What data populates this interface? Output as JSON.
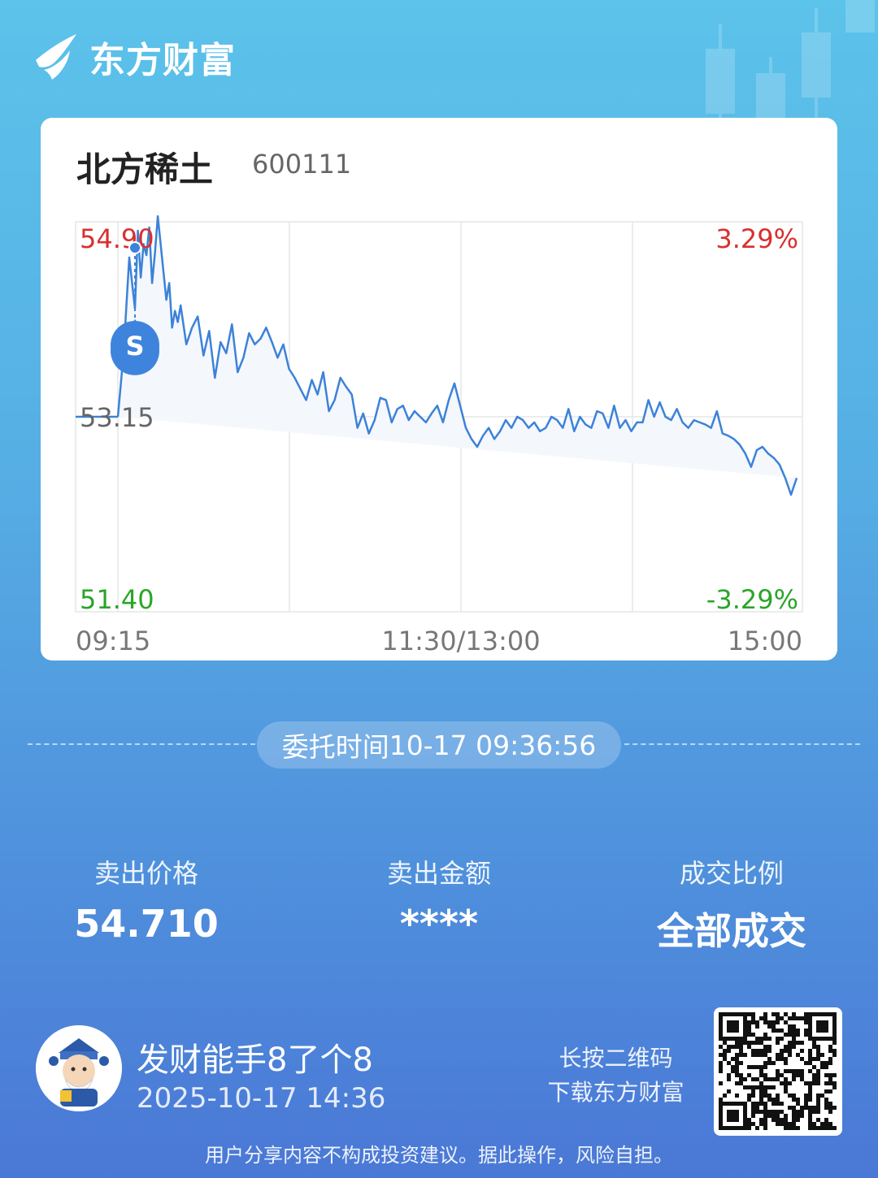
{
  "brand": {
    "name": "东方财富"
  },
  "stock": {
    "name": "北方稀土",
    "code": "600111"
  },
  "chart_data": {
    "type": "line",
    "y_labels": {
      "top_price": "54.90",
      "mid_price": "53.15",
      "bottom_price": "51.40",
      "top_pct": "3.29%",
      "bottom_pct": "-3.29%"
    },
    "x_labels": [
      "09:15",
      "11:30/13:00",
      "15:00"
    ],
    "ylim": [
      51.4,
      54.9
    ],
    "x_unit": "trading minutes after 09:30",
    "x": [
      0,
      2,
      4,
      6,
      7,
      8,
      9,
      10,
      11,
      12,
      13,
      14,
      15,
      16,
      17,
      18,
      19,
      20,
      21,
      22,
      24,
      26,
      28,
      30,
      32,
      34,
      36,
      38,
      40,
      42,
      44,
      46,
      48,
      50,
      52,
      54,
      56,
      58,
      60,
      62,
      64,
      66,
      68,
      70,
      72,
      74,
      76,
      78,
      80,
      82,
      84,
      86,
      88,
      90,
      92,
      94,
      96,
      98,
      100,
      102,
      104,
      106,
      108,
      110,
      112,
      114,
      116,
      118,
      120,
      122,
      124,
      126,
      128,
      130,
      132,
      134,
      136,
      138,
      140,
      142,
      144,
      146,
      148,
      150,
      152,
      154,
      156,
      158,
      160,
      162,
      164,
      166,
      168,
      170,
      172,
      174,
      176,
      178,
      180,
      182,
      184,
      186,
      188,
      190,
      192,
      194,
      196,
      198,
      200,
      202,
      204,
      206,
      208,
      210,
      212,
      214,
      216,
      218,
      220,
      222,
      224,
      226,
      228,
      230,
      232,
      234,
      236,
      238,
      240
    ],
    "price": [
      53.15,
      53.72,
      54.58,
      54.12,
      54.82,
      54.4,
      54.7,
      54.6,
      54.85,
      54.35,
      54.62,
      54.95,
      54.7,
      54.45,
      54.2,
      54.35,
      53.95,
      54.1,
      54.0,
      54.15,
      53.8,
      53.95,
      54.05,
      53.7,
      53.92,
      53.5,
      53.82,
      53.72,
      53.98,
      53.55,
      53.68,
      53.9,
      53.8,
      53.85,
      53.95,
      53.82,
      53.68,
      53.8,
      53.58,
      53.5,
      53.4,
      53.3,
      53.48,
      53.35,
      53.55,
      53.2,
      53.3,
      53.5,
      53.42,
      53.35,
      53.05,
      53.18,
      53.0,
      53.12,
      53.32,
      53.3,
      53.1,
      53.22,
      53.25,
      53.12,
      53.2,
      53.15,
      53.1,
      53.18,
      53.25,
      53.1,
      53.3,
      53.45,
      53.25,
      53.05,
      52.95,
      52.88,
      52.98,
      53.05,
      52.95,
      53.02,
      53.12,
      53.05,
      53.15,
      53.12,
      53.05,
      53.1,
      53.02,
      53.05,
      53.15,
      53.12,
      53.05,
      53.22,
      53.02,
      53.15,
      53.08,
      53.05,
      53.2,
      53.18,
      53.05,
      53.25,
      53.05,
      53.12,
      53.02,
      53.1,
      53.1,
      53.3,
      53.15,
      53.28,
      53.15,
      53.12,
      53.22,
      53.1,
      53.05,
      53.12,
      53.1,
      53.08,
      53.05,
      53.2,
      53.0,
      52.98,
      52.95,
      52.9,
      52.82,
      52.7,
      52.85,
      52.88,
      52.82,
      52.78,
      52.72,
      52.6,
      52.45,
      52.6
    ]
  },
  "marker": {
    "label": "S"
  },
  "order": {
    "time_label": "委托时间",
    "time_value": "10-17 09:36:56"
  },
  "stats": [
    {
      "label": "卖出价格",
      "value": "54.710"
    },
    {
      "label": "卖出金额",
      "value": "****"
    },
    {
      "label": "成交比例",
      "value": "全部成交"
    }
  ],
  "user": {
    "name": "发财能手8了个8",
    "time": "2025-10-17 14:36"
  },
  "qr_hint": {
    "line1": "长按二维码",
    "line2": "下载东方财富"
  },
  "disclaimer": "用户分享内容不构成投资建议。据此操作，风险自担。",
  "colors": {
    "up": "#d8302f",
    "down": "#2aa52a",
    "line": "#3c82d8",
    "mid": "#666666"
  }
}
